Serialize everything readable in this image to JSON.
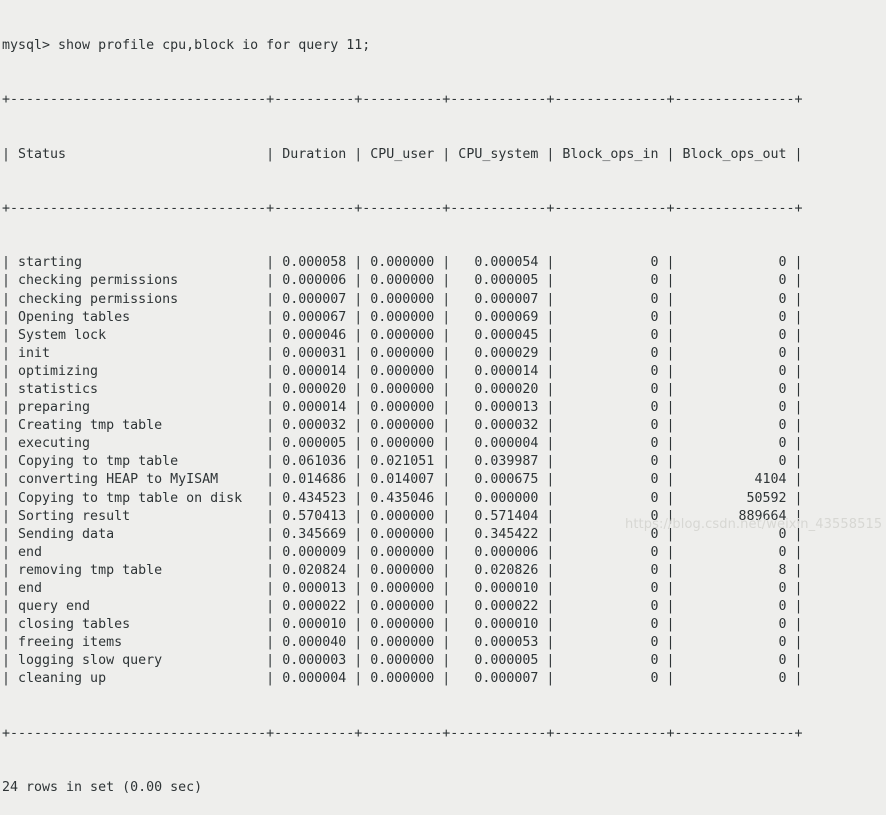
{
  "terminal": {
    "prompt_line": "mysql> show profile cpu,block io for query 11;",
    "footer": "24 rows in set (0.00 sec)",
    "watermark": "https://blog.csdn.net/weixin_43558515",
    "background_color": "#eeeeec",
    "text_color": "#2e3436",
    "watermark_color": "#d7d7d3"
  },
  "table": {
    "columns": [
      {
        "name": "Status",
        "width": 30,
        "align": "left"
      },
      {
        "name": "Duration",
        "width": 8,
        "align": "left"
      },
      {
        "name": "CPU_user",
        "width": 8,
        "align": "left"
      },
      {
        "name": "CPU_system",
        "width": 10,
        "align": "right"
      },
      {
        "name": "Block_ops_in",
        "width": 12,
        "align": "right"
      },
      {
        "name": "Block_ops_out",
        "width": 13,
        "align": "right"
      }
    ],
    "rows": [
      {
        "status": "starting",
        "duration": "0.000058",
        "cpu_user": "0.000000",
        "cpu_system": "0.000054",
        "block_ops_in": "0",
        "block_ops_out": "0"
      },
      {
        "status": "checking permissions",
        "duration": "0.000006",
        "cpu_user": "0.000000",
        "cpu_system": "0.000005",
        "block_ops_in": "0",
        "block_ops_out": "0"
      },
      {
        "status": "checking permissions",
        "duration": "0.000007",
        "cpu_user": "0.000000",
        "cpu_system": "0.000007",
        "block_ops_in": "0",
        "block_ops_out": "0"
      },
      {
        "status": "Opening tables",
        "duration": "0.000067",
        "cpu_user": "0.000000",
        "cpu_system": "0.000069",
        "block_ops_in": "0",
        "block_ops_out": "0"
      },
      {
        "status": "System lock",
        "duration": "0.000046",
        "cpu_user": "0.000000",
        "cpu_system": "0.000045",
        "block_ops_in": "0",
        "block_ops_out": "0"
      },
      {
        "status": "init",
        "duration": "0.000031",
        "cpu_user": "0.000000",
        "cpu_system": "0.000029",
        "block_ops_in": "0",
        "block_ops_out": "0"
      },
      {
        "status": "optimizing",
        "duration": "0.000014",
        "cpu_user": "0.000000",
        "cpu_system": "0.000014",
        "block_ops_in": "0",
        "block_ops_out": "0"
      },
      {
        "status": "statistics",
        "duration": "0.000020",
        "cpu_user": "0.000000",
        "cpu_system": "0.000020",
        "block_ops_in": "0",
        "block_ops_out": "0"
      },
      {
        "status": "preparing",
        "duration": "0.000014",
        "cpu_user": "0.000000",
        "cpu_system": "0.000013",
        "block_ops_in": "0",
        "block_ops_out": "0"
      },
      {
        "status": "Creating tmp table",
        "duration": "0.000032",
        "cpu_user": "0.000000",
        "cpu_system": "0.000032",
        "block_ops_in": "0",
        "block_ops_out": "0"
      },
      {
        "status": "executing",
        "duration": "0.000005",
        "cpu_user": "0.000000",
        "cpu_system": "0.000004",
        "block_ops_in": "0",
        "block_ops_out": "0"
      },
      {
        "status": "Copying to tmp table",
        "duration": "0.061036",
        "cpu_user": "0.021051",
        "cpu_system": "0.039987",
        "block_ops_in": "0",
        "block_ops_out": "0"
      },
      {
        "status": "converting HEAP to MyISAM",
        "duration": "0.014686",
        "cpu_user": "0.014007",
        "cpu_system": "0.000675",
        "block_ops_in": "0",
        "block_ops_out": "4104"
      },
      {
        "status": "Copying to tmp table on disk",
        "duration": "0.434523",
        "cpu_user": "0.435046",
        "cpu_system": "0.000000",
        "block_ops_in": "0",
        "block_ops_out": "50592"
      },
      {
        "status": "Sorting result",
        "duration": "0.570413",
        "cpu_user": "0.000000",
        "cpu_system": "0.571404",
        "block_ops_in": "0",
        "block_ops_out": "889664"
      },
      {
        "status": "Sending data",
        "duration": "0.345669",
        "cpu_user": "0.000000",
        "cpu_system": "0.345422",
        "block_ops_in": "0",
        "block_ops_out": "0"
      },
      {
        "status": "end",
        "duration": "0.000009",
        "cpu_user": "0.000000",
        "cpu_system": "0.000006",
        "block_ops_in": "0",
        "block_ops_out": "0"
      },
      {
        "status": "removing tmp table",
        "duration": "0.020824",
        "cpu_user": "0.000000",
        "cpu_system": "0.020826",
        "block_ops_in": "0",
        "block_ops_out": "8"
      },
      {
        "status": "end",
        "duration": "0.000013",
        "cpu_user": "0.000000",
        "cpu_system": "0.000010",
        "block_ops_in": "0",
        "block_ops_out": "0"
      },
      {
        "status": "query end",
        "duration": "0.000022",
        "cpu_user": "0.000000",
        "cpu_system": "0.000022",
        "block_ops_in": "0",
        "block_ops_out": "0"
      },
      {
        "status": "closing tables",
        "duration": "0.000010",
        "cpu_user": "0.000000",
        "cpu_system": "0.000010",
        "block_ops_in": "0",
        "block_ops_out": "0"
      },
      {
        "status": "freeing items",
        "duration": "0.000040",
        "cpu_user": "0.000000",
        "cpu_system": "0.000053",
        "block_ops_in": "0",
        "block_ops_out": "0"
      },
      {
        "status": "logging slow query",
        "duration": "0.000003",
        "cpu_user": "0.000000",
        "cpu_system": "0.000005",
        "block_ops_in": "0",
        "block_ops_out": "0"
      },
      {
        "status": "cleaning up",
        "duration": "0.000004",
        "cpu_user": "0.000000",
        "cpu_system": "0.000007",
        "block_ops_in": "0",
        "block_ops_out": "0"
      }
    ]
  }
}
